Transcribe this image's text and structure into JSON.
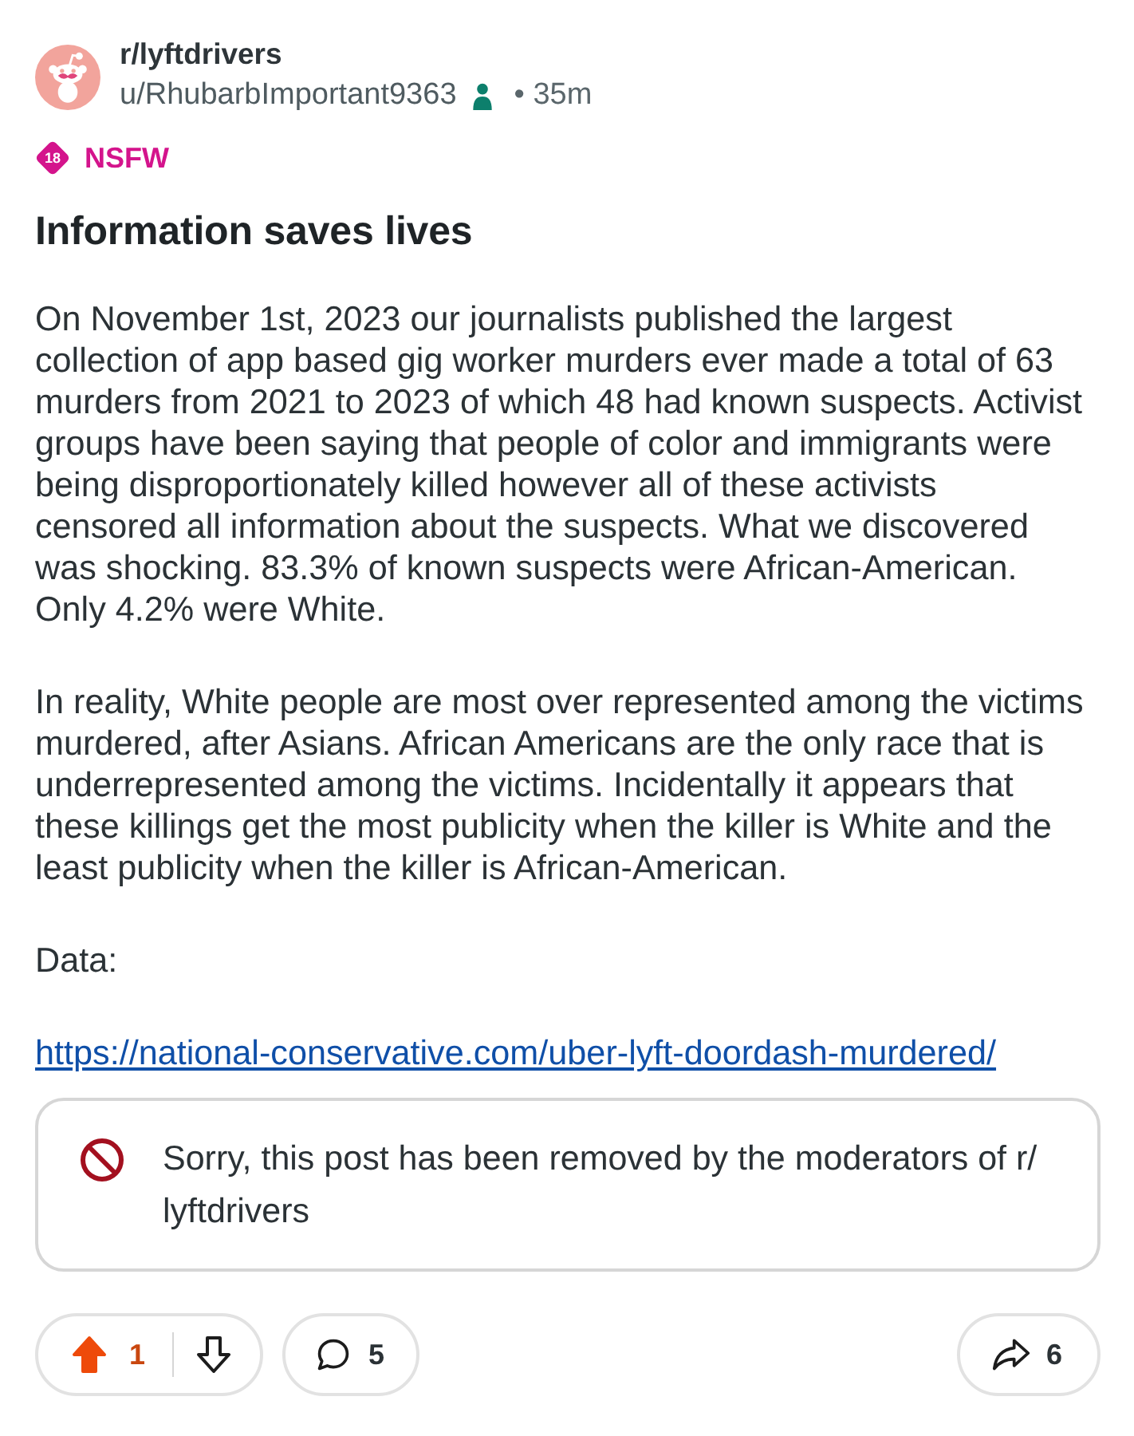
{
  "post": {
    "subreddit": "r/lyftdrivers",
    "author": "u/RhubarbImportant9363",
    "time": "• 35m"
  },
  "nsfw": {
    "age": "18",
    "label": "NSFW"
  },
  "title": "Information saves lives",
  "body": [
    {
      "kind": "text",
      "text": "On November 1st, 2023 our journalists published the largest collection of app based gig worker murders ever made a total of 63 murders from 2021 to 2023 of which 48 had known suspects. Activist groups have been saying that people of color and immigrants were being disproportionately killed however all of these activists censored all information about the suspects. What we discovered was shocking. 83.3% of known suspects were African-American. Only 4.2% were White."
    },
    {
      "kind": "text",
      "text": "In reality, White people are most over represented among the victims murdered, after Asians. African Americans are the only race that is underrepresented among the victims. Incidentally it appears that these killings get the most publicity when the killer is White and the least publicity when the killer is African-American."
    },
    {
      "kind": "text",
      "text": "Data:"
    },
    {
      "kind": "link",
      "text": "https://national-conservative.com/uber-lyft-doordash-murdered/"
    }
  ],
  "removed_notice": {
    "message": "Sorry, this post has been removed by the moderators of r/lyftdrivers"
  },
  "actions": {
    "vote": {
      "upvoted": true,
      "downvoted": false,
      "score": "1"
    },
    "comments": "5",
    "shares": "6"
  }
}
